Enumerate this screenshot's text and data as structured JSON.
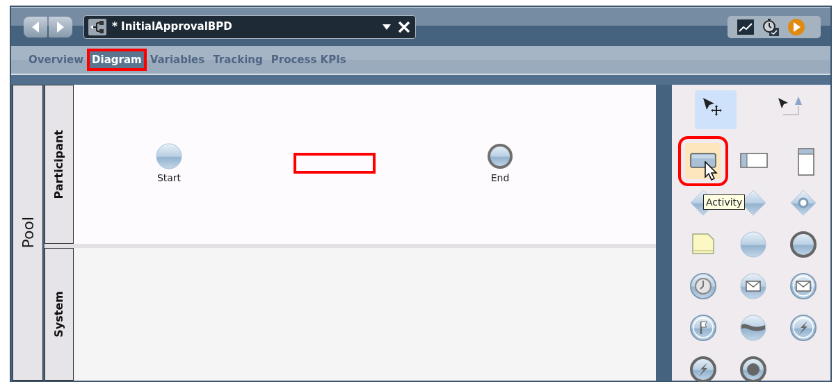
{
  "header": {
    "title": "* InitialApprovalBPD"
  },
  "tabs": [
    {
      "label": "Overview",
      "selected": false,
      "annotated": false
    },
    {
      "label": "Diagram",
      "selected": true,
      "annotated": true
    },
    {
      "label": "Variables",
      "selected": false,
      "annotated": false
    },
    {
      "label": "Tracking",
      "selected": false,
      "annotated": false
    },
    {
      "label": "Process KPIs",
      "selected": false,
      "annotated": false
    }
  ],
  "pool": {
    "label": "Pool"
  },
  "lanes": [
    {
      "label": "Participant",
      "elements": [
        {
          "kind": "start",
          "label": "Start"
        },
        {
          "kind": "placeholder"
        },
        {
          "kind": "end",
          "label": "End"
        }
      ]
    },
    {
      "label": "System"
    }
  ],
  "palette": {
    "items": [
      {
        "kind": "select",
        "selected": true,
        "hovered": false
      },
      {
        "kind": "connect",
        "selected": false,
        "hovered": false
      },
      {
        "kind": "activity",
        "selected": false,
        "hovered": true
      },
      {
        "kind": "lane-box",
        "selected": false,
        "hovered": false
      },
      {
        "kind": "column-box",
        "selected": false,
        "hovered": false
      },
      {
        "kind": "diamond",
        "selected": false,
        "hovered": false
      },
      {
        "kind": "diamond",
        "selected": false,
        "hovered": false
      },
      {
        "kind": "diamond-circle",
        "selected": false,
        "hovered": false
      },
      {
        "kind": "note",
        "selected": false,
        "hovered": false
      },
      {
        "kind": "circle",
        "selected": false,
        "hovered": false
      },
      {
        "kind": "ring",
        "selected": false,
        "hovered": false
      },
      {
        "kind": "clock",
        "selected": false,
        "hovered": false
      },
      {
        "kind": "envelope",
        "selected": false,
        "hovered": false
      },
      {
        "kind": "envelope-ring",
        "selected": false,
        "hovered": false
      },
      {
        "kind": "flag",
        "selected": false,
        "hovered": false
      },
      {
        "kind": "wave",
        "selected": false,
        "hovered": false
      },
      {
        "kind": "lightning-ring",
        "selected": false,
        "hovered": false
      },
      {
        "kind": "lightning",
        "selected": false,
        "hovered": false
      },
      {
        "kind": "dot",
        "selected": false,
        "hovered": false
      }
    ],
    "tooltip": "Activity"
  }
}
